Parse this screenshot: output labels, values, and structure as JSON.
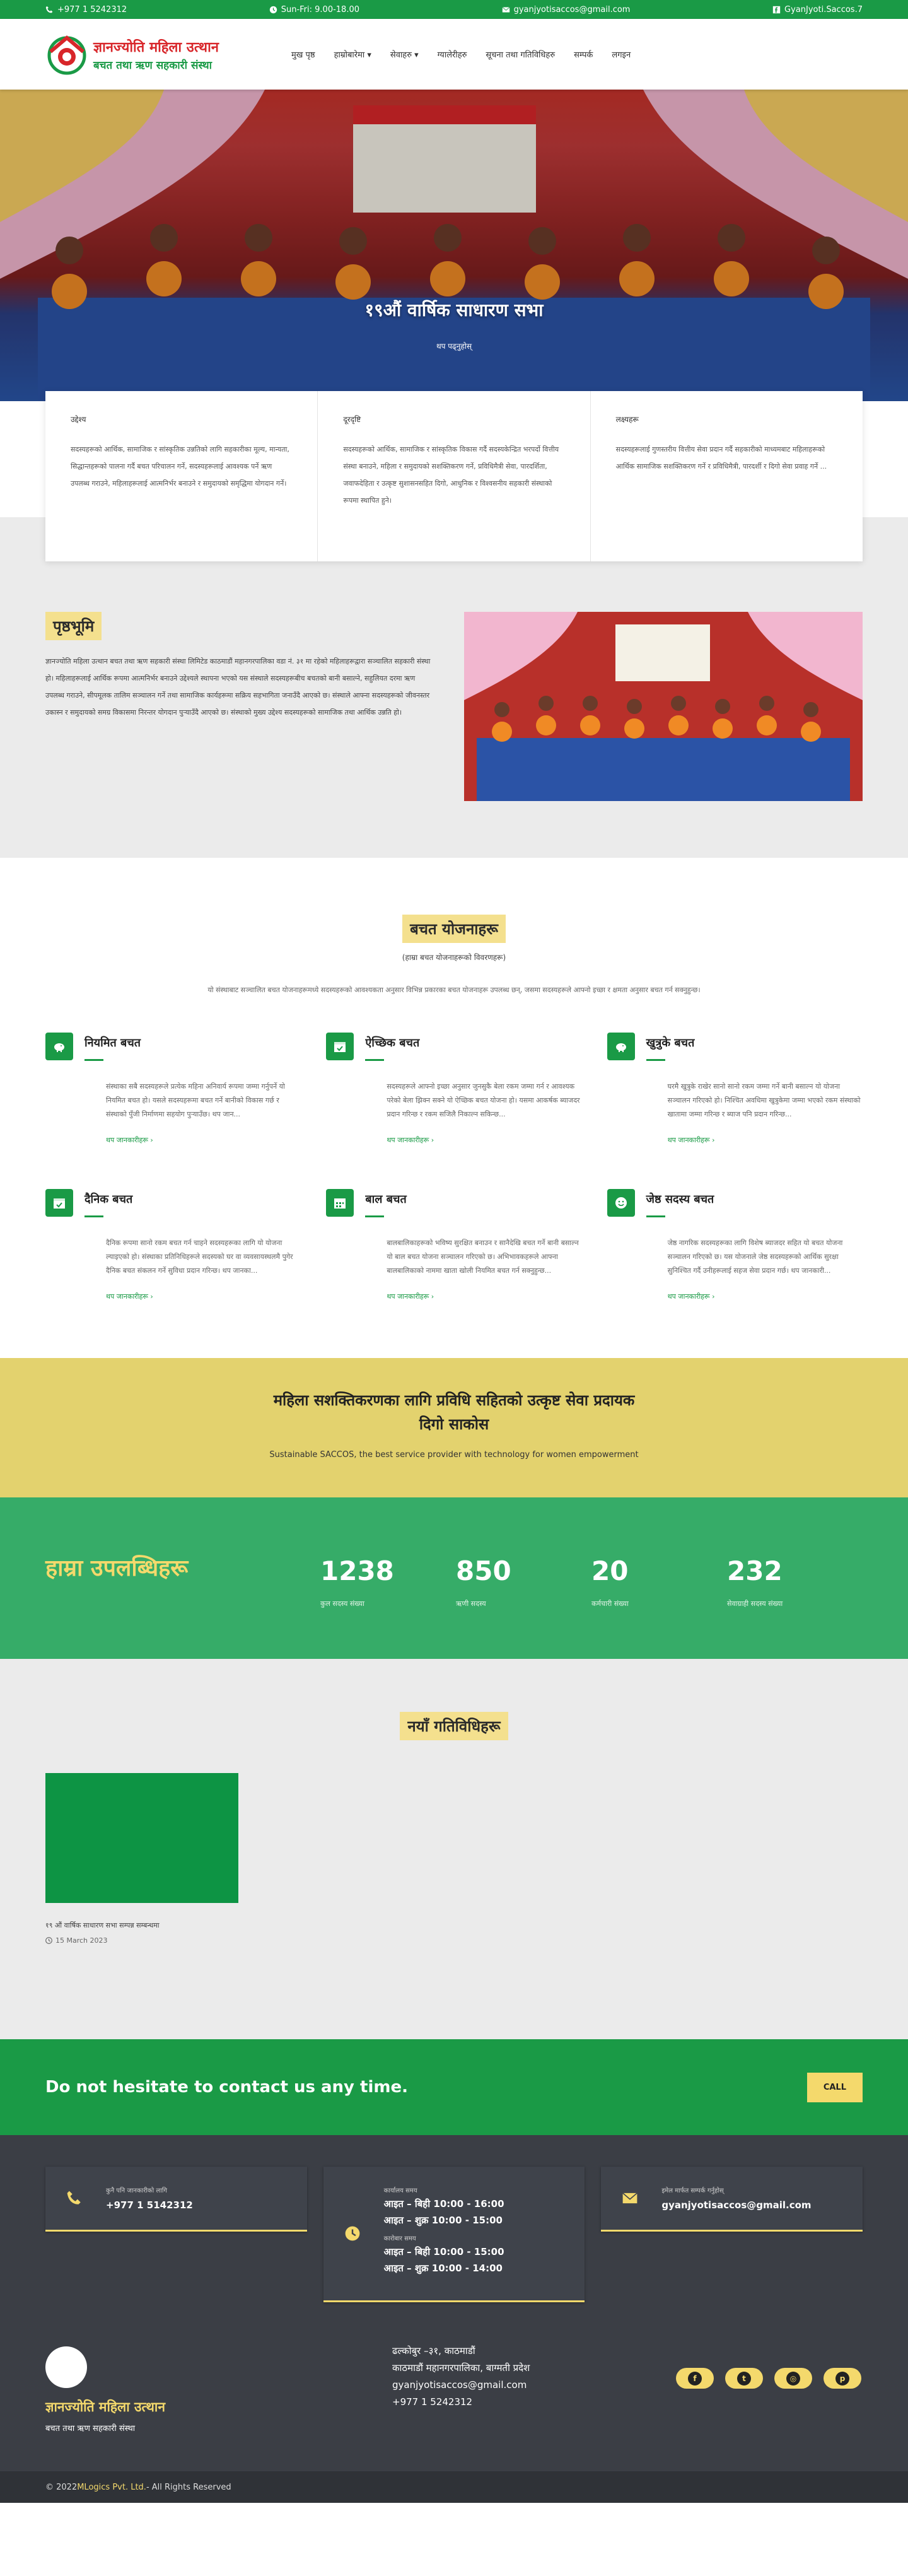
{
  "topbar": {
    "phone": "+977 1 5242312",
    "hours": "Sun-Fri: 9.00-18.00",
    "email": "gyanjyotisaccos@gmail.com",
    "facebook": "GyanJyoti.Saccos.7"
  },
  "brand": {
    "name": "ज्ञानज्योति महिला उत्थान",
    "tagline": "बचत तथा ऋण सहकारी संस्था",
    "colors": {
      "green": "#1a9a46",
      "red": "#d8262a",
      "yellow": "#f4d96c"
    }
  },
  "nav": {
    "items": [
      "मुख पृष्ठ",
      "हाम्रोबारेमा ▾",
      "सेवाहरु ▾",
      "ग्यालेरीहरु",
      "सूचना तथा गतिविधिहरु",
      "सम्पर्क",
      "लगइन"
    ]
  },
  "hero": {
    "title": "१९औं वार्षिक साधारण सभा",
    "subtitle": "थप पढ्नुहोस्"
  },
  "cards": [
    {
      "title": "उद्देश्य",
      "text": "सदस्यहरूको आर्थिक, सामाजिक र सांस्कृतिक उन्नतिको लागि सहकारीका मूल्य, मान्यता, सिद्धान्तहरूको पालना गर्दै बचत परिचालन गर्ने, सदस्यहरूलाई आवश्यक पर्ने ऋण उपलब्ध गराउने, महिलाहरूलाई आत्मनिर्भर बनाउने र समुदायको समृद्धिमा योगदान गर्ने।"
    },
    {
      "title": "दूरदृष्टि",
      "text": "सदस्यहरूको आर्थिक, सामाजिक र सांस्कृतिक विकास गर्दै सदस्यकेन्द्रित भरपर्दो वित्तीय संस्था बनाउने, महिला र समुदायको सशक्तिकरण गर्ने, प्रविधिमैत्री सेवा, पारदर्शिता, जवाफदेहिता र उत्कृष्ट सुशासनसहित दिगो, आधुनिक र विश्वसनीय सहकारी संस्थाको रूपमा स्थापित हुने।"
    },
    {
      "title": "लक्ष्यहरू",
      "text": "सदस्यहरूलाई गुणस्तरीय वित्तीय सेवा प्रदान गर्दै सहकारीको माध्यमबाट महिलाहरूको आर्थिक सामाजिक सशक्तिकरण गर्ने र प्रविधिमैत्री, पारदर्शी र दिगो सेवा प्रवाह गर्ने ..."
    }
  ],
  "background": {
    "title": "पृष्ठभूमि",
    "text": "ज्ञानज्योति महिला उत्थान बचत तथा ऋण सहकारी संस्था लिमिटेड काठमाडौं महानगरपालिका वडा नं. ३१ मा रहेको महिलाहरूद्वारा सञ्चालित सहकारी संस्था हो। महिलाहरूलाई आर्थिक रूपमा आत्मनिर्भर बनाउने उद्देश्यले स्थापना भएको यस संस्थाले सदस्यहरूबीच बचतको बानी बसाल्ने, सहुलियत दरमा ऋण उपलब्ध गराउने, सीपमूलक तालिम सञ्चालन गर्ने तथा सामाजिक कार्यहरूमा सक्रिय सहभागिता जनाउँदै आएको छ। संस्थाले आफ्ना सदस्यहरूको जीवनस्तर उकास्न र समुदायको समग्र विकासमा निरन्तर योगदान पुर्‍याउँदै आएको छ। संस्थाको मुख्य उद्देश्य सदस्यहरूको सामाजिक तथा आर्थिक उन्नति हो।"
  },
  "savings": {
    "title": "बचत योजनाहरू",
    "subtitle": "(हाम्रा बचत योजनाहरूको विवरणहरू)",
    "description": "यो संस्थाबाट सञ्चालित बचत योजनाहरूमध्ये सदस्यहरूको आवश्यकता अनुसार विभिन्न प्रकारका बचत योजनाहरू उपलब्ध छन्, जसमा सदस्यहरूले आफ्नो इच्छा र क्षमता अनुसार बचत गर्न सक्नुहुन्छ।",
    "more_label": "थप जानकारीहरू ›",
    "plans": [
      {
        "title": "नियमित बचत",
        "icon": "piggy-bank-icon",
        "text": "संस्थाका सबै सदस्यहरूले प्रत्येक महिना अनिवार्य रूपमा जम्मा गर्नुपर्ने यो नियमित बचत हो। यसले सदस्यहरूमा बचत गर्ने बानीको विकास गर्छ र संस्थाको पुँजी निर्माणमा सहयोग पुर्‍याउँछ। थप जान..."
      },
      {
        "title": "ऐच्छिक बचत",
        "icon": "calendar-check-icon",
        "text": "सदस्यहरूले आफ्नो इच्छा अनुसार जुनसुकै बेला रकम जम्मा गर्न र आवश्यक परेको बेला झिक्न सक्ने यो ऐच्छिक बचत योजना हो। यसमा आकर्षक ब्याजदर प्रदान गरिन्छ र रकम सजिलै निकाल्न सकिन्छ..."
      },
      {
        "title": "खुत्रुके बचत",
        "icon": "piggy-bank-icon",
        "text": "घरमै खुत्रुके राखेर सानो सानो रकम जम्मा गर्ने बानी बसाल्न यो योजना सञ्चालन गरिएको हो। निश्चित अवधिमा खुत्रुकेमा जम्मा भएको रकम संस्थाको खातामा जम्मा गरिन्छ र ब्याज पनि प्रदान गरिन्छ..."
      },
      {
        "title": "दैनिक बचत",
        "icon": "calendar-check-icon",
        "text": "दैनिक रूपमा सानो रकम बचत गर्न चाहने सदस्यहरूका लागि यो योजना ल्याइएको हो। संस्थाका प्रतिनिधिहरूले सदस्यको घर वा व्यवसायस्थलमै पुगेर दैनिक बचत संकलन गर्ने सुविधा प्रदान गरिन्छ। थप जानका..."
      },
      {
        "title": "बाल बचत",
        "icon": "calendar-icon",
        "text": "बालबालिकाहरूको भविष्य सुरक्षित बनाउन र सानैदेखि बचत गर्ने बानी बसाल्न यो बाल बचत योजना सञ्चालन गरिएको छ। अभिभावकहरूले आफ्ना बालबालिकाको नाममा खाता खोली नियमित बचत गर्न सक्नुहुन्छ..."
      },
      {
        "title": "जेष्ठ सदस्य बचत",
        "icon": "smiley-icon",
        "text": "जेष्ठ नागरिक सदस्यहरूका लागि विशेष ब्याजदर सहित यो बचत योजना सञ्चालन गरिएको छ। यस योजनाले जेष्ठ सदस्यहरूको आर्थिक सुरक्षा सुनिश्चित गर्दै उनीहरूलाई सहज सेवा प्रदान गर्छ। थप जानकारी..."
      }
    ]
  },
  "banner": {
    "title_line1": "महिला सशक्तिकरणका लागि प्रविधि सहितको उत्कृष्ट सेवा प्रदायक",
    "title_line2": "दिगो साकोस",
    "subtitle": "Sustainable SACCOS, the best service provider with technology for women empowerment"
  },
  "achievements": {
    "title": "हाम्रा उपलब्धिहरू",
    "stats": [
      {
        "value": "1238",
        "label": "कुल सदस्य संख्या"
      },
      {
        "value": "850",
        "label": "ऋणी सदस्य"
      },
      {
        "value": "20",
        "label": "कर्मचारी संख्या"
      },
      {
        "value": "232",
        "label": "सेवाग्राही सदस्य संख्या"
      }
    ]
  },
  "activities": {
    "title": "नयाँ गतिविधिहरू",
    "items": [
      {
        "title": "१९ औं वार्षिक साधारण सभा सम्पन्न सम्बन्धमा",
        "date": "15 March 2023"
      }
    ]
  },
  "cta": {
    "text": "Do not hesitate to contact us any time.",
    "button": "CALL"
  },
  "footer": {
    "phone": {
      "label": "कुनै पनि जानकारीको लागि",
      "value": "+977 1 5142312"
    },
    "hours": [
      {
        "label": "कार्यालय समय",
        "line1": "आइत – बिही 10:00 - 16:00",
        "line2": "आइत – शुक्र 10:00 - 15:00"
      },
      {
        "label": "कारोबार समय",
        "line1": "आइत – बिही 10:00 - 15:00",
        "line2": "आइत – शुक्र 10:00 - 14:00"
      }
    ],
    "email": {
      "label": "इमेल मार्फत सम्पर्क गर्नुहोस्",
      "value": "gyanjyotisaccos@gmail.com"
    },
    "brand_name": "ज्ञानज्योति महिला उत्थान",
    "brand_tagline": "बचत तथा ऋण सहकारी संस्था",
    "address": [
      "ढल्कोबुर –३१, काठमाडौं",
      "काठमाडौं महानगरपालिका, बाग्मती प्रदेश",
      "gyanjyotisaccos@gmail.com",
      "+977 1 5242312"
    ],
    "socials": [
      "facebook-icon",
      "twitter-icon",
      "instagram-icon",
      "pinterest-icon"
    ],
    "copyright_prefix": "© 2022 ",
    "copyright_brand": "MLogics Pvt. Ltd.",
    "copyright_suffix": " - All Rights Reserved"
  }
}
